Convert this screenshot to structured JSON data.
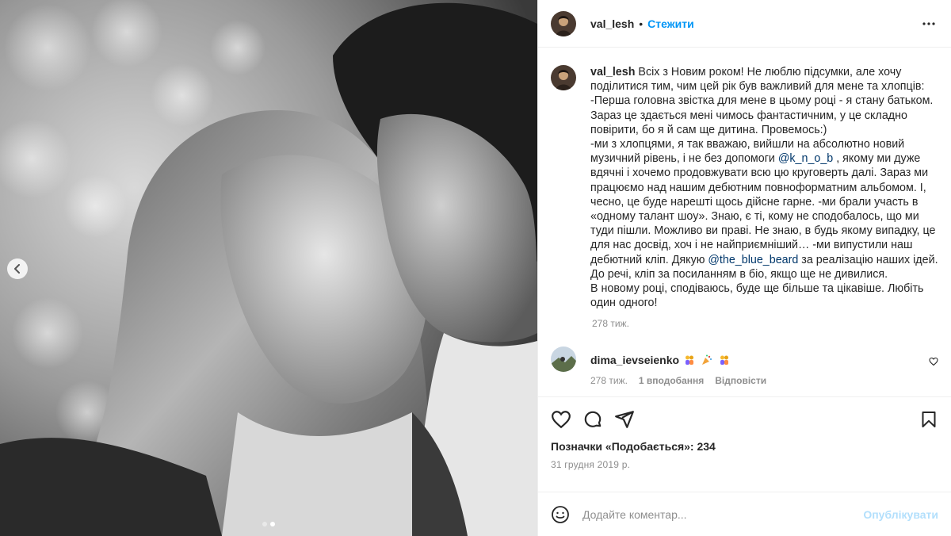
{
  "post": {
    "username": "val_lesh",
    "separator": "•",
    "follow_label": "Стежити",
    "caption_username": "val_lesh",
    "caption_parts": [
      " Всіх з Новим роком! Не люблю підсумки, але хочу поділитися тим, чим цей рік був важливий для мене та хлопців:\n-Перша головна звістка для мене в цьому році - я стану батьком. Зараз це здається мені чимось фантастичним, у це складно повірити, бо я й сам ще дитина. Провемось:)\n-ми з хлопцями, я так вважаю, вийшли на абсолютно новий музичний рівень, і не без допомоги ",
      "@k_n_o_b",
      " , якому ми дуже вдячні і хочемо продовжувати всю цю круговерть далі. Зараз ми працюємо над нашим дебютним повноформатним альбомом. І, чесно, це буде нарешті щось дійсне гарне. -ми брали участь в «одному талант шоу». Знаю, є ті, кому не сподобалось, що ми туди пішли. Можливо ви праві. Не знаю, в будь якому випадку, це для нас досвід, хоч і не найприємніший… -ми випустили наш дебютний кліп. Дякую ",
      "@the_blue_beard",
      " за реалізацію наших ідей. До речі, кліп за посиланням в біо, якщо ще не дивилися.\nВ новому році, сподіваюсь, буде ще більше та цікавіше. Любіть один одного!"
    ],
    "caption_time": "278 тиж.",
    "comment": {
      "username": "dima_ievseienko",
      "emojis": [
        "people-hugging-emoji",
        "party-popper-emoji",
        "people-hugging-emoji"
      ],
      "time": "278 тиж.",
      "likes": "1 вподобання",
      "reply_label": "Відповісти"
    },
    "likes_text": "Позначки «Подобається»: 234",
    "date": "31 грудня 2019 р.",
    "comment_input_placeholder": "Додайте коментар...",
    "publish_label": "Опублікувати",
    "carousel": {
      "total": 2,
      "active_index": 1
    }
  },
  "colors": {
    "accent": "#0095f6",
    "mention": "#00376b",
    "muted": "#8e8e8e",
    "publish_disabled": "#b2dffc"
  }
}
